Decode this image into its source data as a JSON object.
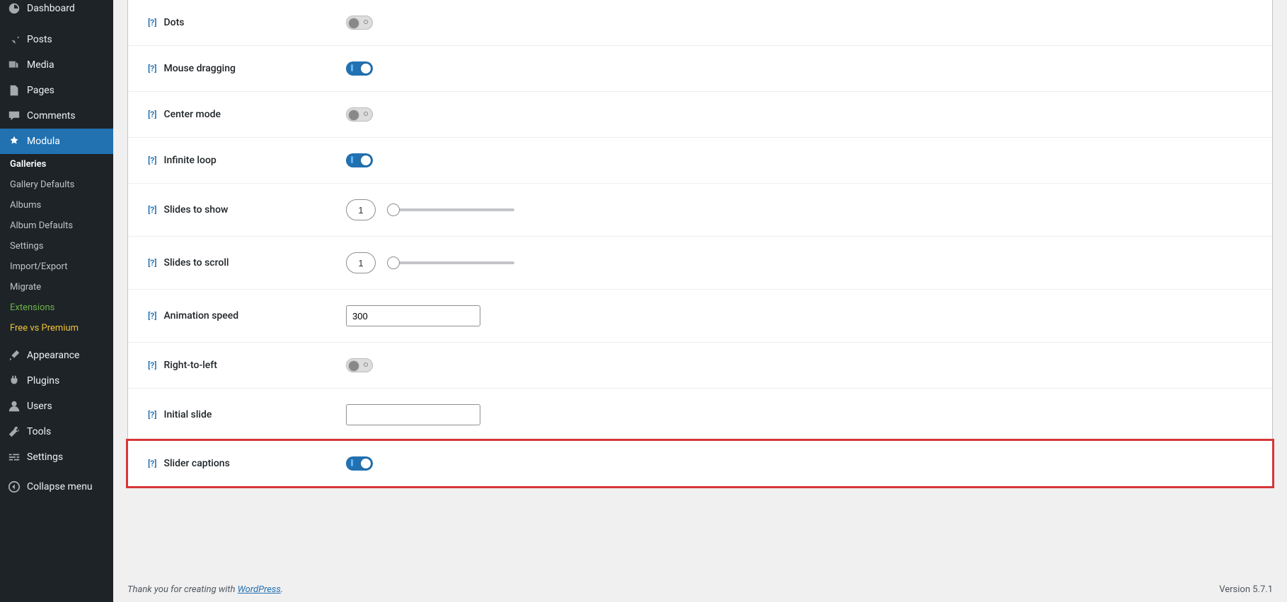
{
  "sidebar": {
    "main": [
      {
        "label": "Dashboard"
      },
      {
        "label": "Posts"
      },
      {
        "label": "Media"
      },
      {
        "label": "Pages"
      },
      {
        "label": "Comments"
      },
      {
        "label": "Modula"
      }
    ],
    "sub": [
      {
        "label": "Galleries"
      },
      {
        "label": "Gallery Defaults"
      },
      {
        "label": "Albums"
      },
      {
        "label": "Album Defaults"
      },
      {
        "label": "Settings"
      },
      {
        "label": "Import/Export"
      },
      {
        "label": "Migrate"
      },
      {
        "label": "Extensions"
      },
      {
        "label": "Free vs Premium"
      }
    ],
    "lower": [
      {
        "label": "Appearance"
      },
      {
        "label": "Plugins"
      },
      {
        "label": "Users"
      },
      {
        "label": "Tools"
      },
      {
        "label": "Settings"
      },
      {
        "label": "Collapse menu"
      }
    ]
  },
  "help_glyph": "[?]",
  "settings": {
    "dots": {
      "label": "Dots",
      "on": false
    },
    "mouse_dragging": {
      "label": "Mouse dragging",
      "on": true
    },
    "center_mode": {
      "label": "Center mode",
      "on": false
    },
    "infinite_loop": {
      "label": "Infinite loop",
      "on": true
    },
    "slides_to_show": {
      "label": "Slides to show",
      "value": "1"
    },
    "slides_to_scroll": {
      "label": "Slides to scroll",
      "value": "1"
    },
    "animation_speed": {
      "label": "Animation speed",
      "value": "300"
    },
    "rtl": {
      "label": "Right-to-left",
      "on": false
    },
    "initial_slide": {
      "label": "Initial slide",
      "value": ""
    },
    "slider_captions": {
      "label": "Slider captions",
      "on": true
    }
  },
  "footer": {
    "thanks_prefix": "Thank you for creating with ",
    "wp": "WordPress",
    "period": ".",
    "version": "Version 5.7.1"
  }
}
